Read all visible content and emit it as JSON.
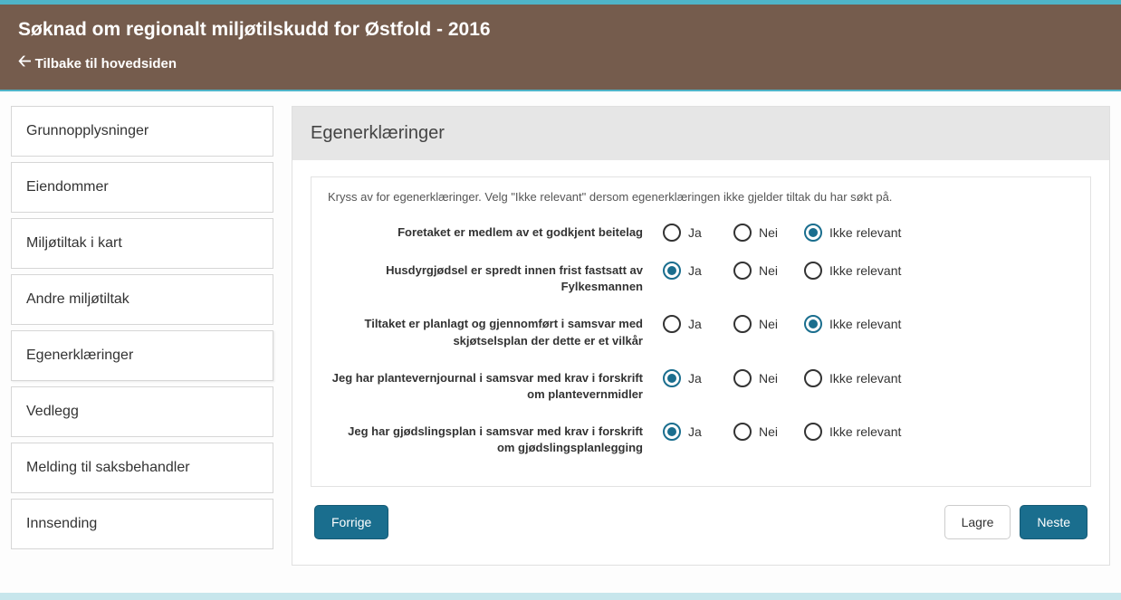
{
  "header": {
    "title": "Søknad om regionalt miljøtilskudd for Østfold - 2016",
    "back_label": "Tilbake til hovedsiden"
  },
  "sidebar": {
    "items": [
      {
        "label": "Grunnopplysninger",
        "active": false
      },
      {
        "label": "Eiendommer",
        "active": false
      },
      {
        "label": "Miljøtiltak i kart",
        "active": false
      },
      {
        "label": "Andre miljøtiltak",
        "active": false
      },
      {
        "label": "Egenerklæringer",
        "active": true
      },
      {
        "label": "Vedlegg",
        "active": false
      },
      {
        "label": "Melding til saksbehandler",
        "active": false
      },
      {
        "label": "Innsending",
        "active": false
      }
    ]
  },
  "main": {
    "title": "Egenerklæringer",
    "info": "Kryss av for egenerklæringer. Velg \"Ikke relevant\" dersom egenerklæringen ikke gjelder tiltak du har søkt på.",
    "option_labels": {
      "ja": "Ja",
      "nei": "Nei",
      "ikke": "Ikke relevant"
    },
    "questions": [
      {
        "text": "Foretaket er medlem av et godkjent beitelag",
        "selected": "ikke"
      },
      {
        "text": "Husdyrgjødsel er spredt innen frist fastsatt av Fylkesmannen",
        "selected": "ja"
      },
      {
        "text": "Tiltaket er planlagt og gjennomført i samsvar med skjøtselsplan der dette er et vilkår",
        "selected": "ikke"
      },
      {
        "text": "Jeg har plantevernjournal i samsvar med krav i forskrift om plantevernmidler",
        "selected": "ja"
      },
      {
        "text": "Jeg har gjødslingsplan i samsvar med krav i forskrift om gjødslingsplanlegging",
        "selected": "ja"
      }
    ],
    "buttons": {
      "prev": "Forrige",
      "save": "Lagre",
      "next": "Neste"
    }
  }
}
